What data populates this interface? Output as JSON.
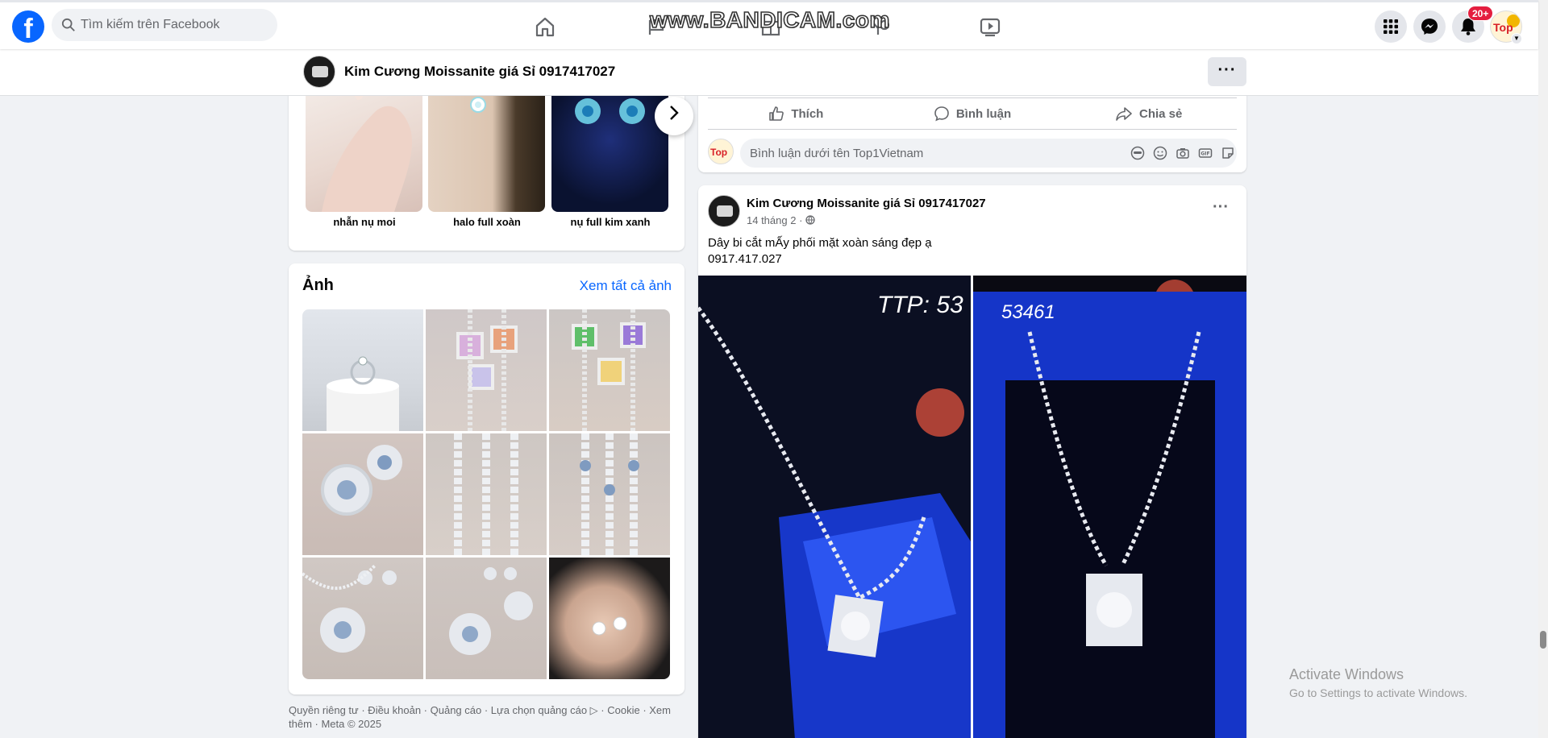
{
  "topbar": {
    "search_placeholder": "Tìm kiếm trên Facebook",
    "watermark": "www.BANDICAM.com",
    "notification_count": "20+",
    "avatar_initials": "Top",
    "icons": [
      "facebook-logo",
      "search-icon",
      "home-icon",
      "friends-icon",
      "marketplace-icon",
      "groups-icon",
      "video-icon",
      "menu-grid-icon",
      "messenger-icon",
      "bell-icon"
    ]
  },
  "pagebar": {
    "title": "Kim Cương Moissanite giá Sỉ 0917417027",
    "more_label": "···"
  },
  "featured": {
    "items": [
      {
        "label": "nhẫn nụ moi"
      },
      {
        "label": "halo full xoàn"
      },
      {
        "label": "nụ full kim xanh"
      }
    ]
  },
  "photos": {
    "title": "Ảnh",
    "see_all": "Xem tất cả ảnh",
    "count": 9
  },
  "footer": {
    "text": "Quyền riêng tư · Điều khoản · Quảng cáo · Lựa chọn quảng cáo ▷ · Cookie · Xem thêm · Meta © 2025"
  },
  "actions": {
    "like": "Thích",
    "comment": "Bình luận",
    "share": "Chia sẻ",
    "comment_placeholder": "Bình luận dưới tên Top1Vietnam",
    "commenter_initials": "Top"
  },
  "post": {
    "author": "Kim Cương Moissanite giá Sỉ 0917417027",
    "date": "14 tháng 2",
    "text_line1": "Dây bi cắt mẤy phối mặt xoàn sáng đẹp ạ",
    "text_line2": "0917.417.027",
    "image_left_code": "TTP: 53",
    "image_right_code": "53461",
    "more_label": "···"
  },
  "os_overlay": {
    "title": "Activate Windows",
    "subtitle": "Go to Settings to activate Windows."
  },
  "colors": {
    "brand": "#0866ff",
    "badge": "#e41e3f",
    "box_blue": "#1a3fd6"
  }
}
